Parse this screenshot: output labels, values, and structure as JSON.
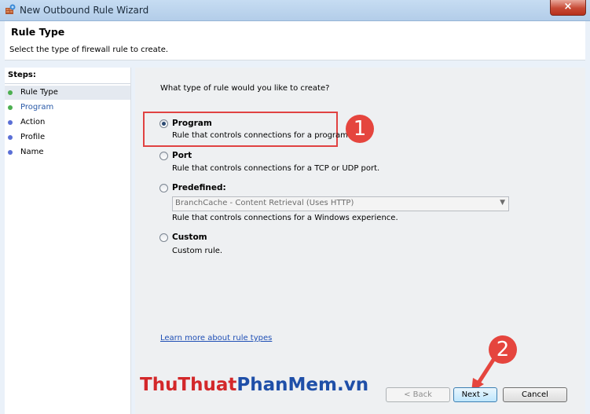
{
  "window": {
    "title": "New Outbound Rule Wizard",
    "close_symbol": "×"
  },
  "header": {
    "title": "Rule Type",
    "subtitle": "Select the type of firewall rule to create."
  },
  "steps": {
    "label": "Steps:",
    "items": [
      {
        "label": "Rule Type",
        "active": true,
        "color": "#4caf50"
      },
      {
        "label": "Program",
        "active": false,
        "color": "#4caf50"
      },
      {
        "label": "Action",
        "active": false,
        "color": "#5a6fd6"
      },
      {
        "label": "Profile",
        "active": false,
        "color": "#5a6fd6"
      },
      {
        "label": "Name",
        "active": false,
        "color": "#5a6fd6"
      }
    ]
  },
  "main": {
    "question": "What type of rule would you like to create?",
    "options": [
      {
        "label": "Program",
        "description": "Rule that controls connections for a program.",
        "selected": true
      },
      {
        "label": "Port",
        "description": "Rule that controls connections for a TCP or UDP port.",
        "selected": false
      },
      {
        "label": "Predefined:",
        "description": "Rule that controls connections for a Windows experience.",
        "selected": false
      },
      {
        "label": "Custom",
        "description": "Custom rule.",
        "selected": false
      }
    ],
    "predefined_select_value": "BranchCache - Content Retrieval (Uses HTTP)",
    "link": "Learn more about rule types"
  },
  "annotations": {
    "one": "1",
    "two": "2"
  },
  "watermark": {
    "part1": "ThuThuat",
    "part2": "PhanMem.vn"
  },
  "buttons": {
    "back": "< Back",
    "next": "Next >",
    "cancel": "Cancel"
  },
  "colors": {
    "annotation": "#e5453e",
    "link": "#1f4fb5"
  }
}
